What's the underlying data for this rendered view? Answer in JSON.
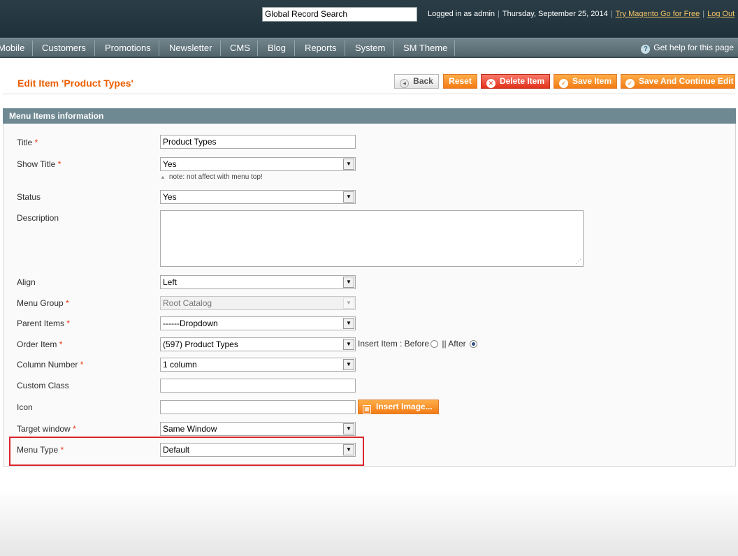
{
  "header": {
    "search_value": "Global Record Search",
    "logged_in": "Logged in as admin",
    "date": "Thursday, September 25, 2014",
    "try_link": "Try Magento Go for Free",
    "logout": "Log Out"
  },
  "nav": {
    "items": [
      "Mobile",
      "Customers",
      "Promotions",
      "Newsletter",
      "CMS",
      "Blog",
      "Reports",
      "System",
      "SM Theme"
    ],
    "help": "Get help for this page"
  },
  "page": {
    "title": "Edit Item 'Product Types'"
  },
  "buttons": {
    "back": "Back",
    "reset": "Reset",
    "delete": "Delete Item",
    "save": "Save Item",
    "save_continue": "Save And Continue Edit"
  },
  "fieldset": {
    "legend": "Menu Items information"
  },
  "form": {
    "title": {
      "label": "Title",
      "value": "Product Types"
    },
    "show_title": {
      "label": "Show Title",
      "value": "Yes",
      "note": "note: not affect with menu top!"
    },
    "status": {
      "label": "Status",
      "value": "Yes"
    },
    "description": {
      "label": "Description",
      "value": ""
    },
    "align": {
      "label": "Align",
      "value": "Left"
    },
    "menu_group": {
      "label": "Menu Group",
      "value": "Root Catalog"
    },
    "parent_items": {
      "label": "Parent Items",
      "value": "------Dropdown"
    },
    "order_item": {
      "label": "Order Item",
      "value": "(597) Product Types",
      "insert_label": "Insert Item : Before",
      "after_label": "|| After"
    },
    "column_number": {
      "label": "Column Number",
      "value": "1 column"
    },
    "custom_class": {
      "label": "Custom Class",
      "value": ""
    },
    "icon": {
      "label": "Icon",
      "value": "",
      "insert_button": "Insert Image..."
    },
    "target_window": {
      "label": "Target window",
      "value": "Same Window"
    },
    "menu_type": {
      "label": "Menu Type",
      "value": "Default"
    }
  },
  "required_mark": "*",
  "colors": {
    "accent": "#eb5e00",
    "header": "#2b3e47",
    "nav": "#6a7d84",
    "highlight": "#d9262c"
  }
}
